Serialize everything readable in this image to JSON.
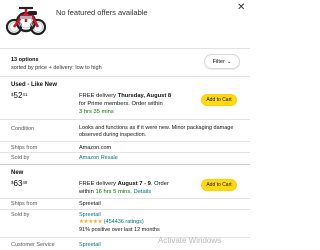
{
  "header": {
    "product_image": "red-tricycle-image",
    "no_offers": "No featured offers available",
    "close_icon": "close-icon"
  },
  "summary": {
    "options": "13 options",
    "sorted": "sorted by price + delivery: low to high",
    "filter_label": "Filter",
    "filter_icon": "chevron-down-icon"
  },
  "offers": [
    {
      "condition": "Used - Like New",
      "price_symbol": "$",
      "price_whole": "52",
      "price_fraction": "41",
      "ship_prefix": "FREE delivery ",
      "ship_date": "Thursday, August 8",
      "ship_mid": "for Prime members. Order within",
      "ship_countdown": "3 hrs 35 mins",
      "add_to_cart": "Add to Cart",
      "condition_label": "Condition",
      "condition_text": "Looks and functions as if it were new. Minor packaging damage observed during inspection.",
      "ships_from_label": "Ships from",
      "ships_from": "Amazon.com",
      "sold_by_label": "Sold by",
      "sold_by": "Amazon Resale"
    },
    {
      "condition": "New",
      "price_symbol": "$",
      "price_whole": "63",
      "price_fraction": "49",
      "ship_prefix": "FREE delivery ",
      "ship_date": "August 7 - 9",
      "ship_mid": ". Order",
      "ship_countdown_prefix": "within ",
      "ship_countdown": "16 hrs 5 mins",
      "details": "Details",
      "add_to_cart": "Add to Cart",
      "ships_from_label": "Ships from",
      "ships_from": "Spreetail",
      "sold_by_label": "Sold by",
      "sold_by": "Spreetail",
      "rating_stars": "★★★★★",
      "rating_count": "(454436 ratings)",
      "positive": "91% positive over last 12 months",
      "customer_service_label": "Customer Service",
      "customer_service": "Spreetail"
    }
  ],
  "watermark": "Activate Windows",
  "colors": {
    "accent_yellow": "#ffd814",
    "link": "#007185",
    "green": "#007600",
    "star": "#ffa41c"
  }
}
